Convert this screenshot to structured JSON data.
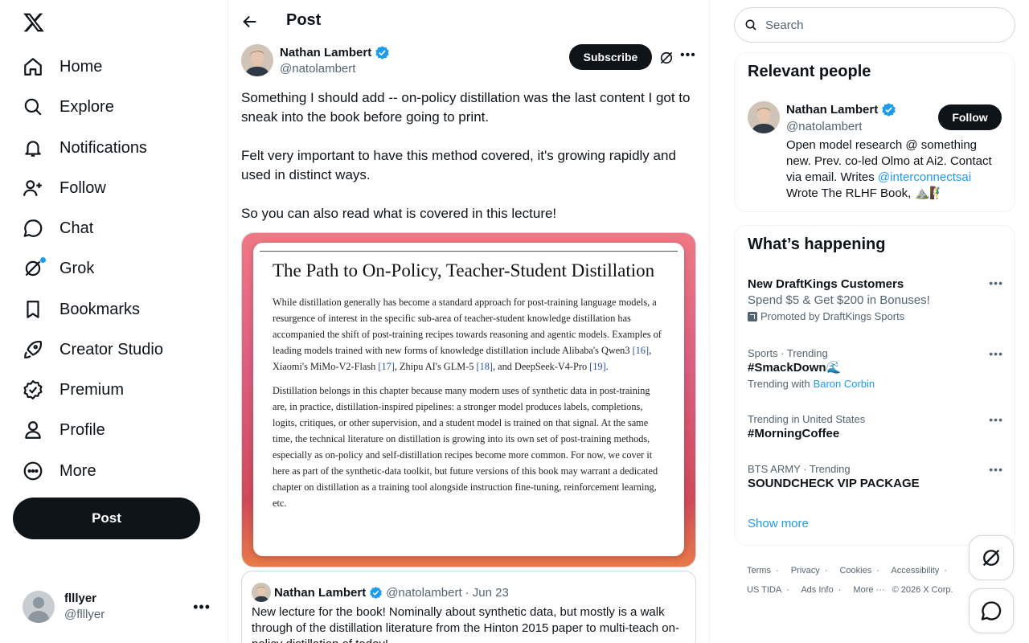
{
  "nav": {
    "items": [
      {
        "label": "Home",
        "icon": "home-icon"
      },
      {
        "label": "Explore",
        "icon": "search-icon"
      },
      {
        "label": "Notifications",
        "icon": "bell-icon"
      },
      {
        "label": "Follow",
        "icon": "person-plus-icon"
      },
      {
        "label": "Chat",
        "icon": "chat-icon"
      },
      {
        "label": "Grok",
        "icon": "grok-icon"
      },
      {
        "label": "Bookmarks",
        "icon": "bookmark-icon"
      },
      {
        "label": "Creator Studio",
        "icon": "rocket-icon"
      },
      {
        "label": "Premium",
        "icon": "verified-badge-icon"
      },
      {
        "label": "Profile",
        "icon": "person-icon"
      },
      {
        "label": "More",
        "icon": "more-circle-icon"
      }
    ],
    "post_label": "Post",
    "account": {
      "name": "flllyer",
      "handle": "@flllyer"
    }
  },
  "main": {
    "title": "Post",
    "author": {
      "name": "Nathan Lambert",
      "handle": "@natolambert",
      "verified": true
    },
    "subscribe_label": "Subscribe",
    "text": [
      "Something I should add -- on-policy distillation was the last content I got to sneak into the book before going to print.",
      "Felt very important to have this method covered, it's growing rapidly and used in distinct ways.",
      "So you can also read what is covered in this lecture!"
    ],
    "media": {
      "title": "The Path to On-Policy, Teacher-Student Distillation",
      "para1_text": "While distillation generally has become a standard approach for post-training language models, a resurgence of interest in the specific sub-area of teacher-student knowledge distillation has accompanied the shift of post-training recipes towards reasoning and agentic models. Examples of leading models trained with new forms of knowledge distillation include Alibaba's Qwen3",
      "para1_refs": [
        "[16]",
        "[17]",
        "[18]",
        "[19]"
      ],
      "para1_mid": [
        ", Xiaomi's MiMo-V2-Flash ",
        ", Zhipu AI's GLM-5 ",
        ", and DeepSeek-V4-Pro ",
        "."
      ],
      "para2": "Distillation belongs in this chapter because many modern uses of synthetic data in post-training are, in practice, distillation-inspired pipelines: a stronger model produces labels, completions, logits, critiques, or other supervision, and a student model is trained on that signal. At the same time, the technical literature on distillation is growing into its own set of post-training methods, especially as on-policy and self-distillation recipes become more common. For now, we cover it here as part of the synthetic-data toolkit, but future versions of this book may warrant a dedicated chapter on distillation as a training tool alongside instruction fine-tuning, reinforcement learning, etc."
    },
    "quote": {
      "name": "Nathan Lambert",
      "handle": "@natolambert",
      "date": "· Jun 23",
      "text": "New lecture for the book! Nominally about synthetic data, but mostly is a walk through of the distillation literature from the Hinton 2015 paper to multi-teach on-policy distillation of today!"
    }
  },
  "right": {
    "search_placeholder": "Search",
    "relevant": {
      "title": "Relevant people",
      "name": "Nathan Lambert",
      "handle": "@natolambert",
      "follow_label": "Follow",
      "bio_1": "Open model research @ something new. Prev. co-led Olmo at Ai2. Contact via email. Writes ",
      "bio_mention": "@interconnectsai",
      "bio_2": "Wrote The RLHF Book, ⛰️🧗‍♂️"
    },
    "happening": {
      "title": "What’s happening",
      "promo": {
        "name": "New DraftKings Customers",
        "sub": "Spend $5 & Get $200 in Bonuses!",
        "promoted": "Promoted by DraftKings Sports"
      },
      "trends": [
        {
          "meta": "Sports · Trending",
          "name": "#SmackDown🌊",
          "with_label": "Trending with",
          "with_link": "Baron Corbin"
        },
        {
          "meta": "Trending in United States",
          "name": "#MorningCoffee"
        },
        {
          "meta": "BTS ARMY · Trending",
          "name": "SOUNDCHECK VIP PACKAGE"
        }
      ],
      "show_more": "Show more"
    },
    "footer": {
      "links": [
        "Terms",
        "Privacy",
        "Cookies",
        "Accessibility",
        "US TIDA",
        "Ads Info",
        "More ···"
      ],
      "copyright": "© 2026 X Corp."
    }
  },
  "colors": {
    "accent": "#1d9bf0",
    "text": "#0f1419",
    "muted": "#536471",
    "border": "#eff3f4"
  }
}
